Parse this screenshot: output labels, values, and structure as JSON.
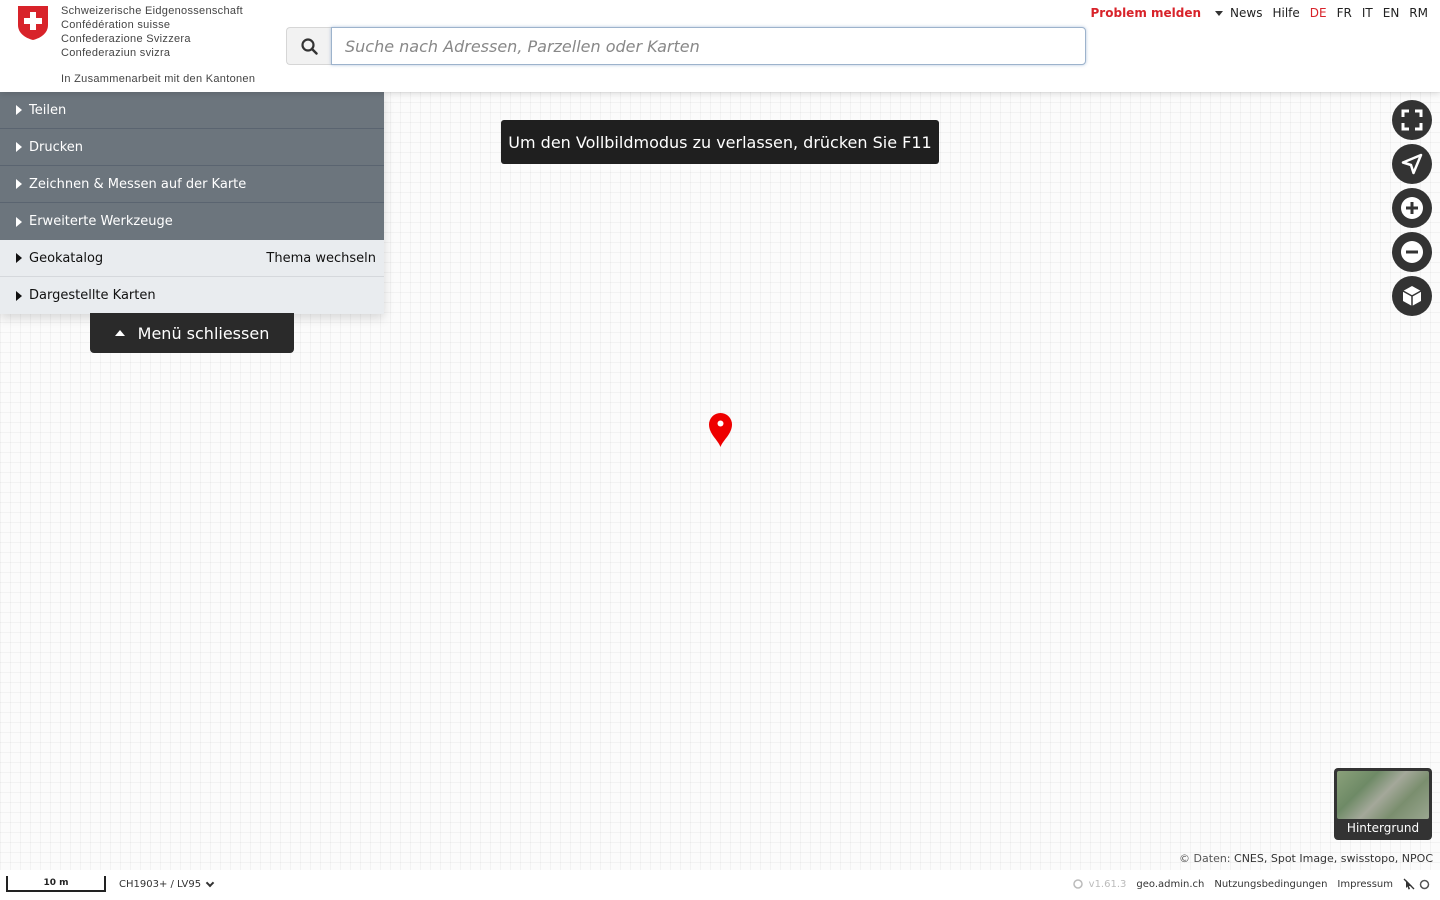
{
  "header": {
    "confederation": [
      "Schweizerische Eidgenossenschaft",
      "Confédération suisse",
      "Confederazione Svizzera",
      "Confederaziun svizra"
    ],
    "collaboration": "In Zusammenarbeit mit den Kantonen",
    "search": {
      "placeholder": "Suche nach Adressen, Parzellen oder Karten",
      "value": ""
    },
    "problem_label": "Problem melden",
    "news_label": "News",
    "help_label": "Hilfe",
    "languages": [
      "DE",
      "FR",
      "IT",
      "EN",
      "RM"
    ],
    "active_language": "DE"
  },
  "menu": {
    "items": [
      {
        "label": "Teilen"
      },
      {
        "label": "Drucken"
      },
      {
        "label": "Zeichnen & Messen auf der Karte"
      },
      {
        "label": "Erweiterte Werkzeuge"
      },
      {
        "label": "Geokatalog",
        "action": "Thema wechseln"
      },
      {
        "label": "Dargestellte Karten"
      }
    ],
    "close_label": "Menü schliessen"
  },
  "toast": "Um den Vollbildmodus zu verlassen, drücken Sie F11",
  "map_controls": [
    "fullscreen-icon",
    "geolocation-icon",
    "zoom-in-icon",
    "zoom-out-icon",
    "3d-icon"
  ],
  "background": {
    "label": "Hintergrund"
  },
  "attribution": {
    "prefix": "© Daten:",
    "sources": "CNES, Spot Image, swisstopo, NPOC"
  },
  "footer": {
    "scale": "10 m",
    "projection": "CH1903+ / LV95",
    "version": "v1.61.3",
    "links": [
      "geo.admin.ch",
      "Nutzungsbedingungen",
      "Impressum"
    ]
  },
  "colors": {
    "accent_red": "#d8232a",
    "menu_dark": "#6c757d",
    "menu_light": "#e9ecef"
  }
}
